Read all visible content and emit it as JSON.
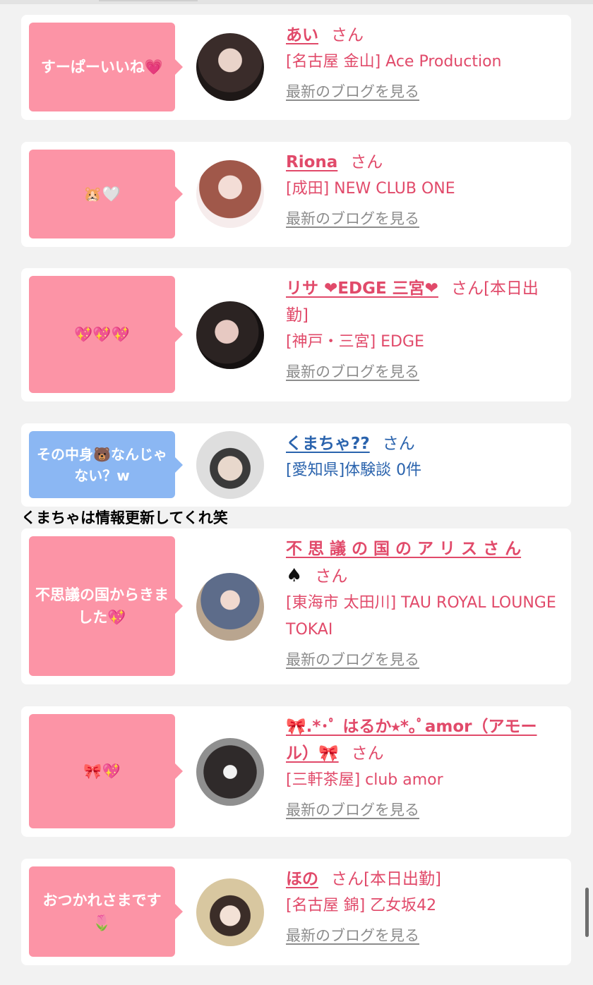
{
  "cards": [
    {
      "bubble": "すーぱーいいね💗",
      "bubble_color": "pink",
      "name": "あい",
      "suffix": "さん",
      "shop": "[名古屋 金山] Ace Production",
      "link": "最新のブログを見る"
    },
    {
      "bubble": "🐹🤍",
      "bubble_color": "pink",
      "name": "Riona",
      "suffix": "さん",
      "shop": "[成田] NEW CLUB ONE",
      "link": "最新のブログを見る"
    },
    {
      "bubble": "💖💖💖",
      "bubble_color": "pink",
      "name": "リサ ❤EDGE 三宮❤",
      "suffix": "さん[本日出勤]",
      "shop": "[神戸・三宮] EDGE",
      "link": "最新のブログを見る"
    },
    {
      "bubble": "その中身🐻なんじゃない？w",
      "bubble_color": "blue",
      "name": "くまちゃ??",
      "suffix": "さん",
      "shop": "[愛知県]体験談 0件"
    },
    {
      "bubble": "不思議の国からきました💖",
      "bubble_color": "pink",
      "name": "不 思 議 の 国 の ア リ ス さ ん",
      "name_extra": "♠",
      "suffix": "さん",
      "shop": "[東海市 太田川] TAU ROYAL LOUNGE TOKAI",
      "link": "最新のブログを見る"
    },
    {
      "bubble": "🎀💖",
      "bubble_color": "pink",
      "name": "🎀.*･ﾟ はるか⭑*｡ﾟamor（アモール）🎀",
      "suffix": "さん",
      "shop": "[三軒茶屋] club amor",
      "link": "最新のブログを見る"
    },
    {
      "bubble": "おつかれさまです🌷",
      "bubble_color": "pink",
      "name": "ほの",
      "suffix": "さん[本日出勤]",
      "shop": "[名古屋 錦] 乙女坂42",
      "link": "最新のブログを見る"
    }
  ],
  "note": "くまちゃは情報更新してくれ笑",
  "colors": {
    "pink_bubble": "#fc94a6",
    "blue_bubble": "#8bb7f3",
    "name_pink": "#e14a6a",
    "name_blue": "#2a63ad",
    "link_gray": "#8c8c8c",
    "background": "#f2f2f2"
  }
}
